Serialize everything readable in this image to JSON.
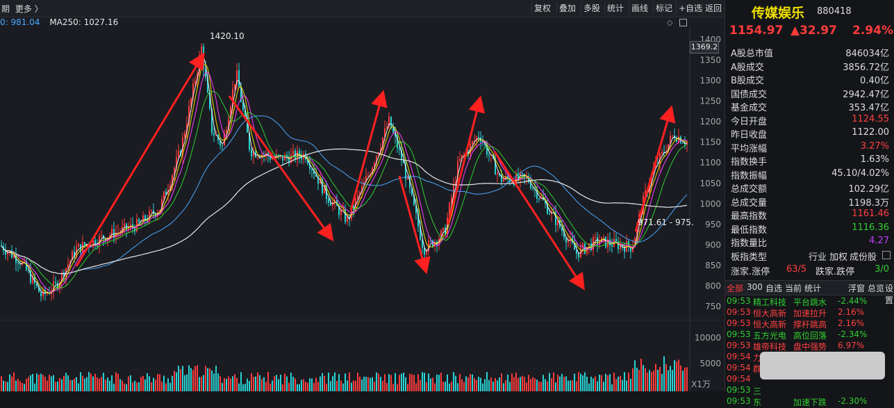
{
  "toolbar": {
    "period_label": "期",
    "more_label": "更多 〉",
    "buttons": [
      "复权",
      "叠加",
      "多股",
      "统计",
      "画线",
      "标记",
      "+自选",
      "返回"
    ]
  },
  "ma_legend": [
    {
      "label": "0: 981.04",
      "color": "#4aa8ff"
    },
    {
      "label": "MA250: 1027.16",
      "color": "#e8e8e8"
    }
  ],
  "annotations": {
    "high_label": "1420.10",
    "price_tag": "1369.2",
    "low_label": "971.61 - 975."
  },
  "price_axis": [
    1400,
    1350,
    1300,
    1250,
    1200,
    1150,
    1100,
    1050,
    1000,
    950,
    900,
    850,
    800,
    750
  ],
  "volume_axis": {
    "labels": [
      "10000",
      "5000"
    ],
    "unit": "X1万"
  },
  "stock": {
    "name": "传媒娱乐",
    "code": "880418",
    "price": "1154.97",
    "change": "▲32.97",
    "change_pct": "2.94%"
  },
  "stats": [
    {
      "k": "A股总市值",
      "v": "846034亿",
      "color": "#dddddd"
    },
    {
      "k": "A股成交",
      "v": "3856.72亿",
      "color": "#dddddd"
    },
    {
      "k": "B股成交",
      "v": "0.40亿",
      "color": "#dddddd"
    },
    {
      "k": "国债成交",
      "v": "2942.47亿",
      "color": "#dddddd"
    },
    {
      "k": "基金成交",
      "v": "353.47亿",
      "color": "#dddddd"
    },
    {
      "k": "今日开盘",
      "v": "1124.55",
      "color": "#ff4040"
    },
    {
      "k": "昨日收盘",
      "v": "1122.00",
      "color": "#dddddd"
    },
    {
      "k": "平均涨幅",
      "v": "3.27%",
      "color": "#ff4040"
    },
    {
      "k": "指数换手",
      "v": "1.63%",
      "color": "#dddddd"
    },
    {
      "k": "指数振幅",
      "v": "45.10/4.02%",
      "color": "#dddddd"
    },
    {
      "k": "总成交额",
      "v": "102.29亿",
      "color": "#dddddd"
    },
    {
      "k": "总成交量",
      "v": "1198.3万",
      "color": "#dddddd"
    },
    {
      "k": "最高指数",
      "v": "1161.46",
      "color": "#ff4040"
    },
    {
      "k": "最低指数",
      "v": "1116.36",
      "color": "#30d030"
    },
    {
      "k": "指数量比",
      "v": "4.27",
      "color": "#c040ff"
    }
  ],
  "sector": {
    "label": "板指类型",
    "items": [
      "行业",
      "加权",
      "成份股"
    ]
  },
  "updown": {
    "up_label": "涨家.涨停",
    "up_val": "63/5",
    "down_label": "跌家.跌停",
    "down_val": "3/0"
  },
  "tabs": [
    "全部",
    "300",
    "自选",
    "当前",
    "统计",
    "浮窗",
    "总览",
    "设置"
  ],
  "news": [
    {
      "time": "09:53",
      "name": "精工科技",
      "event": "平台跳水",
      "pct": "-2.44%",
      "color": "#30d030"
    },
    {
      "time": "09:53",
      "name": "恒大高新",
      "event": "加速拉升",
      "pct": "2.16%",
      "color": "#ff4040"
    },
    {
      "time": "09:53",
      "name": "恒大高新",
      "event": "撑杆跳高",
      "pct": "2.16%",
      "color": "#ff4040"
    },
    {
      "time": "09:53",
      "name": "五方光电",
      "event": "高位回落",
      "pct": "-2.34%",
      "color": "#30d030"
    },
    {
      "time": "09:53",
      "name": "雄帝科技",
      "event": "盘中强势",
      "pct": "6.97%",
      "color": "#ff4040"
    },
    {
      "time": "09:54",
      "name": "力",
      "event": "",
      "pct": "",
      "color": "#ff4040"
    },
    {
      "time": "09:54",
      "name": "群",
      "event": "",
      "pct": "",
      "color": "#ff4040"
    },
    {
      "time": "09:54",
      "name": "",
      "event": "",
      "pct": "",
      "color": "#ff4040"
    },
    {
      "time": "09:53",
      "name": "三",
      "event": "",
      "pct": "",
      "color": "#30d030"
    },
    {
      "time": "09:53",
      "name": "东",
      "event": "加速下跌",
      "pct": "-2.30%",
      "color": "#30d030"
    }
  ]
}
